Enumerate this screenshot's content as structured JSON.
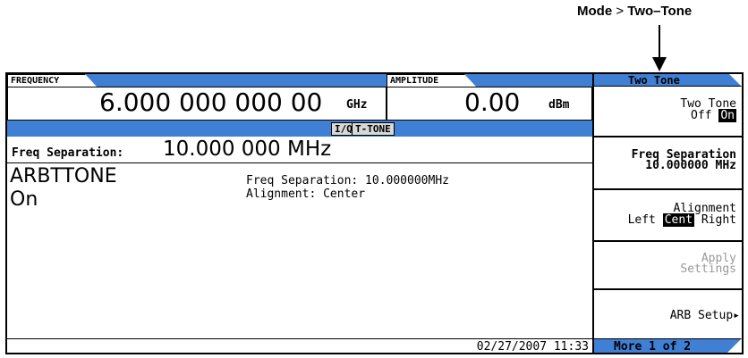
{
  "callout": {
    "mode": "Mode",
    "separator": ">",
    "target": "Two–Tone"
  },
  "frequency": {
    "label": "FREQUENCY",
    "value": "6.000 000 000 00",
    "unit": "GHz"
  },
  "amplitude": {
    "label": "AMPLITUDE",
    "value": "0.00",
    "unit": "dBm"
  },
  "annunciators": [
    "I/Q",
    "T-TONE"
  ],
  "field": {
    "label": "Freq Separation:",
    "value": "10.000 000 MHz"
  },
  "content": {
    "name": "ARBTTONE",
    "state": "On",
    "info_lines": [
      "Freq Separation: 10.000000MHz",
      "Alignment: Center"
    ]
  },
  "timestamp": "02/27/2007 11:33",
  "panel": {
    "title": "Two Tone",
    "keys": {
      "two_tone": {
        "line1": "Two Tone",
        "off": "Off",
        "on": "On"
      },
      "freq_sep": {
        "line1": "Freq Separation",
        "line2": "10.000000 MHz"
      },
      "alignment": {
        "line1": "Alignment",
        "left": "Left",
        "cent": "Cent",
        "right": "Right"
      },
      "apply": {
        "line1": "Apply",
        "line2": "Settings"
      },
      "arb_setup": {
        "label": "ARB Setup",
        "arrow": "▸"
      }
    },
    "more": "More 1 of 2"
  },
  "colors": {
    "accent_blue": "#3f7fd4",
    "annunciator_gray": "#d8d8d8"
  }
}
